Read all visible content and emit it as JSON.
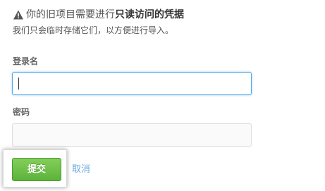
{
  "notice": {
    "icon": "warning-icon",
    "title_prefix": "你的旧项目需要进行",
    "title_emphasis": "只读访问的凭据",
    "subtitle": "我们只会临时存储它们，以方便进行导入。"
  },
  "form": {
    "login": {
      "label": "登录名",
      "value": "",
      "focused": true
    },
    "password": {
      "label": "密码",
      "value": ""
    },
    "submit_label": "提交",
    "cancel_label": "取消"
  },
  "colors": {
    "submit_green": "#5cb33a",
    "link_blue": "#6ba7e0",
    "focus_blue": "#51a7e8"
  }
}
